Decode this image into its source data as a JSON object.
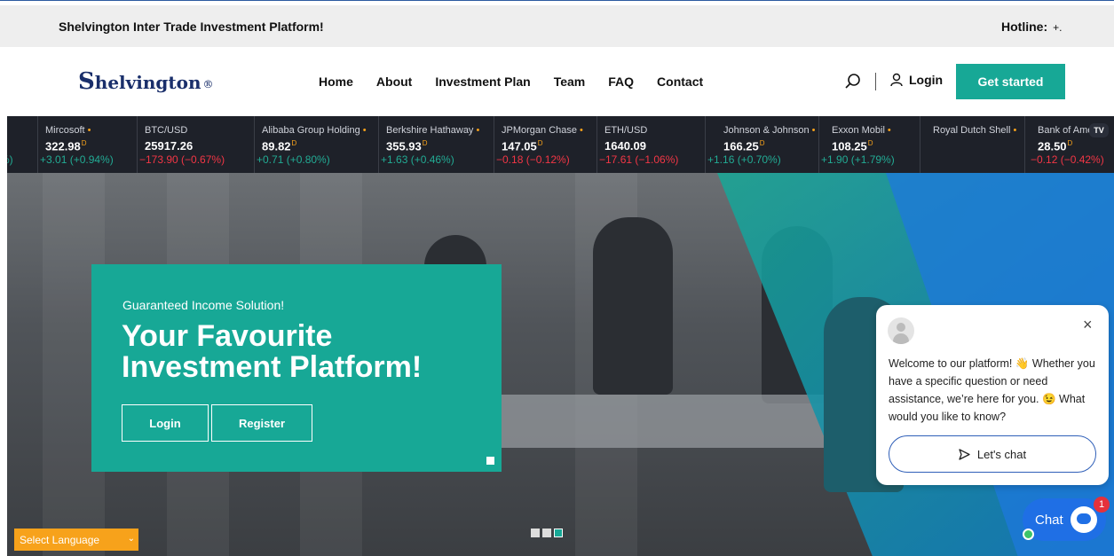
{
  "topbar": {
    "tagline": "Shelvington Inter Trade Investment Platform!",
    "hotline_label": "Hotline:",
    "hotline_value": "+."
  },
  "header": {
    "logo_first": "S",
    "logo_rest": "helvington",
    "logo_mark": "®",
    "nav": [
      "Home",
      "About",
      "Investment Plan",
      "Team",
      "FAQ",
      "Contact"
    ],
    "login": "Login",
    "get_started": "Get started"
  },
  "ticker": {
    "items": [
      {
        "name": "",
        "price": "",
        "delayed": "",
        "change": "%)",
        "dir": "up"
      },
      {
        "name": "Mircosoft",
        "dot": "•",
        "price": "322.98",
        "delayed": "D",
        "change": "+3.01 (+0.94%)",
        "dir": "up"
      },
      {
        "name": "BTC/USD",
        "dot": "",
        "price": "25917.26",
        "delayed": "",
        "change": "−173.90 (−0.67%)",
        "dir": "down"
      },
      {
        "name": "Alibaba Group Holding",
        "dot": "•",
        "price": "89.82",
        "delayed": "D",
        "change": "+0.71 (+0.80%)",
        "dir": "up"
      },
      {
        "name": "Berkshire Hathaway",
        "dot": "•",
        "price": "355.93",
        "delayed": "D",
        "change": "+1.63 (+0.46%)",
        "dir": "up"
      },
      {
        "name": "JPMorgan Chase",
        "dot": "•",
        "price": "147.05",
        "delayed": "D",
        "change": "−0.18 (−0.12%)",
        "dir": "down"
      },
      {
        "name": "ETH/USD",
        "dot": "",
        "price": "1640.09",
        "delayed": "",
        "change": "−17.61 (−1.06%)",
        "dir": "down"
      },
      {
        "name": "Johnson & Johnson",
        "dot": "•",
        "price": "166.25",
        "delayed": "D",
        "change": "+1.16 (+0.70%)",
        "dir": "up"
      },
      {
        "name": "Exxon Mobil",
        "dot": "•",
        "price": "108.25",
        "delayed": "D",
        "change": "+1.90 (+1.79%)",
        "dir": "up"
      },
      {
        "name": "Royal Dutch Shell",
        "dot": "•",
        "price": "",
        "delayed": "",
        "change": "",
        "dir": "up"
      },
      {
        "name": "Bank of Amer",
        "dot": "",
        "price": "28.50",
        "delayed": "D",
        "change": "−0.12 (−0.42%)",
        "dir": "down"
      }
    ],
    "tv_logo": "TV"
  },
  "hero": {
    "eyebrow": "Guaranteed Income Solution!",
    "title": "Your Favourite Investment Platform!",
    "login_btn": "Login",
    "register_btn": "Register",
    "slide_count": 3,
    "active_slide": 3
  },
  "language": {
    "selected": "Select Language",
    "chevron": "⌄"
  },
  "chat": {
    "close": "×",
    "message": "Welcome to our platform! 👋 Whether you have a specific question or need assistance, we’re here for you. 😉 What would you like to know?",
    "cta": "Let's chat",
    "launcher_label": "Chat",
    "badge": "1"
  },
  "colors": {
    "accent": "#17a896",
    "ticker_bg": "#1e2129",
    "up": "#22ab94",
    "down": "#f23645",
    "lang_bg": "#f7a21b",
    "chat_blue": "#1f6fe5"
  }
}
